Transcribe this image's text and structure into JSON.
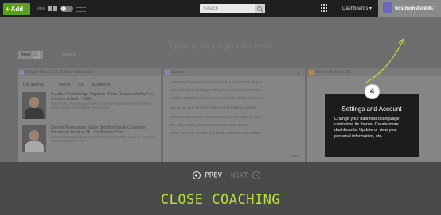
{
  "topbar": {
    "add_label": "Add",
    "view_label": "view",
    "search_placeholder": "Search",
    "dashboards_label": "Dashboards",
    "username": "hostmonsterelle",
    "username_suffix": "USE"
  },
  "page": {
    "title_placeholder": "Type your page title here"
  },
  "tabs": [
    {
      "label": "News",
      "count": "12"
    },
    {
      "label": "General"
    }
  ],
  "widgets": {
    "news": {
      "title": "Google News U.S. Edition - All content",
      "subtabs": [
        "Top Stories",
        "World",
        "US",
        "Business"
      ],
      "stories": [
        {
          "headline": "Kurdish Peshmerga Fighters Claim Responsibility For Kobane Attack - CNN",
          "snippet": "CNN/World: Peshmerga Fighters Claim Responsibility For Kobane Attack (CNN) The Kurdish Peshmerga..."
        },
        {
          "headline": "Detroit Newspaper Editor Jim Notebook Columnist Notebook Dead at 75 - Huffington Post",
          "snippet": "Detroit Newspaper Editor Jim Notebook Columnist Dead at 75 Detroit Sugar Daddy the Free..."
        }
      ],
      "more_label": "more"
    },
    "updates": {
      "title": "Updates",
      "items": [
        "Understanding how to pick and stick to goals that help you...",
        "Yes, planning is the biggest thing for a successful start to...",
        "Product adoptions: thanks & new ideas for better processes",
        "You are at your very best when you are true to yourself",
        "Personal statements: Summarizing your strengths in one...",
        "The daily reading list and what to do about it later",
        "Shine from your chosen and set all one more other ideas"
      ],
      "more_label": "more"
    },
    "nyt": {
      "title": "New York Times US"
    }
  },
  "coaching": {
    "step_number": "4",
    "title": "Settings and Account",
    "body": "Change your dashboard language, customize its theme. Create more dashboards. Update or view your personal information, etc.",
    "prev_label": "PREV",
    "next_label": "NEXT",
    "close_label": "CLOSE COACHING"
  },
  "colors": {
    "accent_green": "#b9e23b",
    "add_button": "#58a01d",
    "callout_bg": "#1c1c1c",
    "avatar": "#6b66c0"
  }
}
